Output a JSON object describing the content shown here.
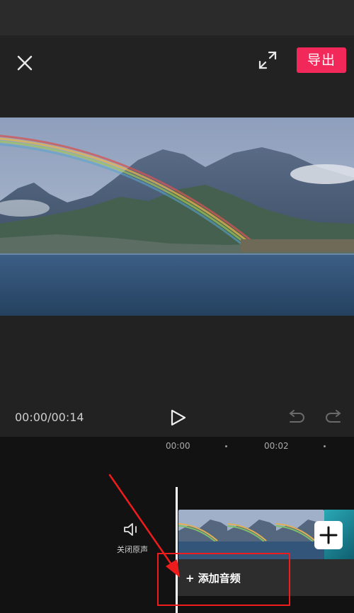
{
  "toolbar": {
    "close_icon": "close-icon",
    "fullscreen_icon": "fullscreen-icon",
    "export_label": "导出",
    "export_color": "#f2285a"
  },
  "preview": {
    "description_icon": "rainbow-lake-video-frame"
  },
  "playback": {
    "timecode": "00:00/00:14",
    "play_icon": "play-icon",
    "undo_icon": "undo-icon",
    "redo_icon": "redo-icon"
  },
  "timeline": {
    "ruler_labels": [
      "00:00",
      "00:02"
    ],
    "mute_label": "关闭原声",
    "mute_icon": "speaker-icon",
    "add_clip_icon": "plus-icon",
    "add_audio_label": "+ 添加音频",
    "highlight_color": "#ee1c1c"
  }
}
